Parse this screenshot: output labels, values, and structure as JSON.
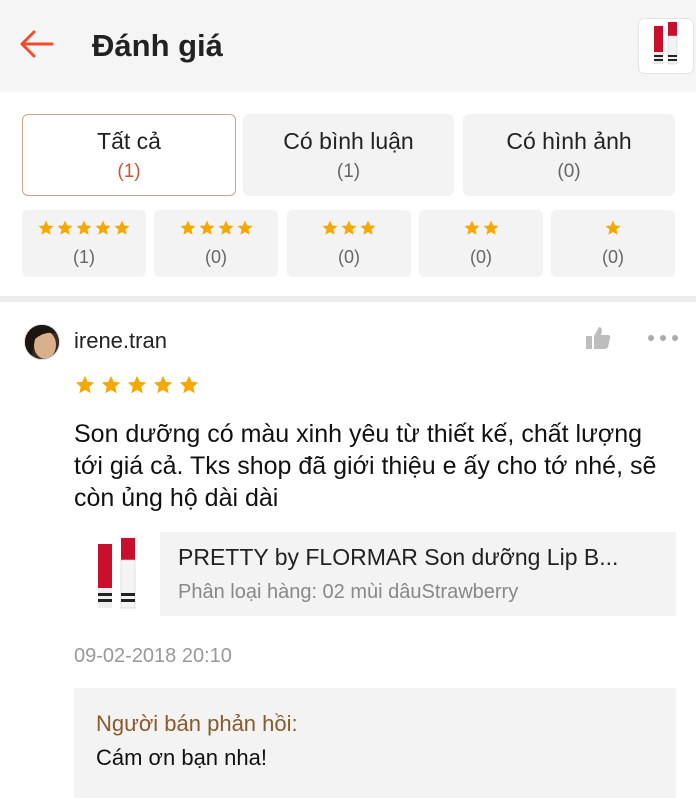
{
  "header": {
    "title": "Đánh giá",
    "back_icon": "arrow-left-icon",
    "accent_color": "#ee4d2d"
  },
  "filters": {
    "tabs": [
      {
        "label": "Tất cả",
        "count": "(1)",
        "active": true
      },
      {
        "label": "Có bình luận",
        "count": "(1)",
        "active": false
      },
      {
        "label": "Có hình ảnh",
        "count": "(0)",
        "active": false
      }
    ],
    "star_tabs": [
      {
        "stars": 5,
        "count": "(1)"
      },
      {
        "stars": 4,
        "count": "(0)"
      },
      {
        "stars": 3,
        "count": "(0)"
      },
      {
        "stars": 2,
        "count": "(0)"
      },
      {
        "stars": 1,
        "count": "(0)"
      }
    ],
    "star_color": "#f6a700"
  },
  "review": {
    "username": "irene.tran",
    "rating": 5,
    "text": "Son dưỡng có màu xinh yêu từ thiết kế, chất lượng tới giá cả. Tks shop đã giới thiệu e ấy cho tớ nhé, sẽ còn ủng hộ dài dài",
    "product": {
      "name": "PRETTY by FLORMAR Son dưỡng Lip B...",
      "variant": "Phân loại hàng: 02 mùi dâuStrawberry"
    },
    "date": "09-02-2018 20:10",
    "seller_reply": {
      "label": "Người bán phản hồi:",
      "text": "Cám ơn bạn nha!"
    }
  }
}
